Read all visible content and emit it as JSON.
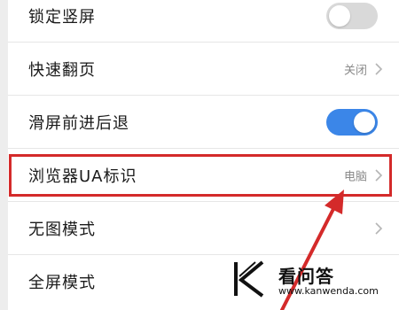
{
  "settings": {
    "items": [
      {
        "label": "锁定竖屏",
        "control": "toggle",
        "state": "off"
      },
      {
        "label": "快速翻页",
        "control": "value",
        "value": "关闭"
      },
      {
        "label": "滑屏前进后退",
        "control": "toggle",
        "state": "on"
      },
      {
        "label": "浏览器UA标识",
        "control": "value",
        "value": "电脑"
      },
      {
        "label": "无图模式",
        "control": "chevron"
      },
      {
        "label": "全屏模式",
        "control": "none"
      }
    ]
  },
  "colors": {
    "toggle_on": "#3b86e8",
    "toggle_off": "#d9d9d9",
    "highlight": "#d42a2a",
    "arrow": "#d42a2a"
  },
  "watermark": {
    "title": "看问答",
    "url": "www.kanwenda.com",
    "icon": "k-logo-icon"
  }
}
